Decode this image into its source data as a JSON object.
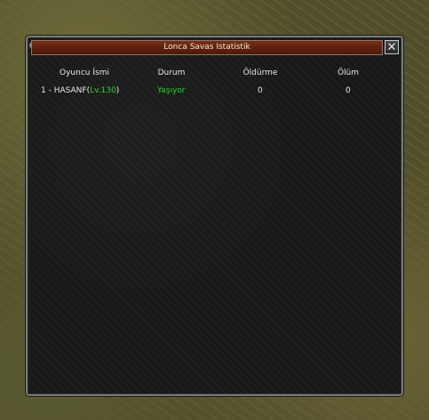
{
  "window": {
    "title": "Lonca Savas Istatistik",
    "close_label": "✕"
  },
  "table": {
    "headers": [
      "Oyuncu İsmi",
      "Durum",
      "Öldürme",
      "Ölüm"
    ],
    "rows": [
      {
        "index": "1",
        "separator": " - ",
        "name": "HASANF",
        "level_open": "(",
        "level": "Lv.130",
        "level_close": ")",
        "status": "Yaşıyor",
        "kills": "0",
        "deaths": "0"
      }
    ]
  },
  "colors": {
    "title_bar": "#6a2512",
    "highlight_green": "#22d622",
    "text": "#e8e8e8"
  },
  "icons": [
    "window-gem-icon",
    "close-icon"
  ]
}
